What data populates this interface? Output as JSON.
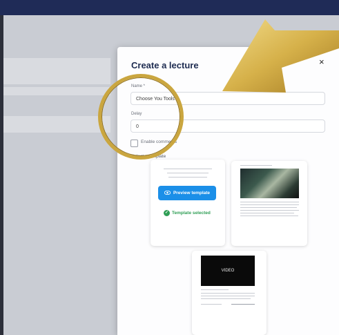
{
  "modal": {
    "title": "Create a lecture",
    "close_icon": "×"
  },
  "form": {
    "name_label": "Name *",
    "name_value": "Choose You Tools",
    "delay_label": "Delay",
    "delay_value": "0",
    "enable_comments_label": "Enable comments",
    "select_template_label": "Select a template"
  },
  "templates": {
    "preview_button": "Preview template",
    "selected_label": "Template selected",
    "video_label": "VIDEO"
  },
  "colors": {
    "brand_blue": "#1b8fe8",
    "success_green": "#2f9e55",
    "title_navy": "#1d2b50",
    "arrow_gold": "#d6b14a"
  }
}
